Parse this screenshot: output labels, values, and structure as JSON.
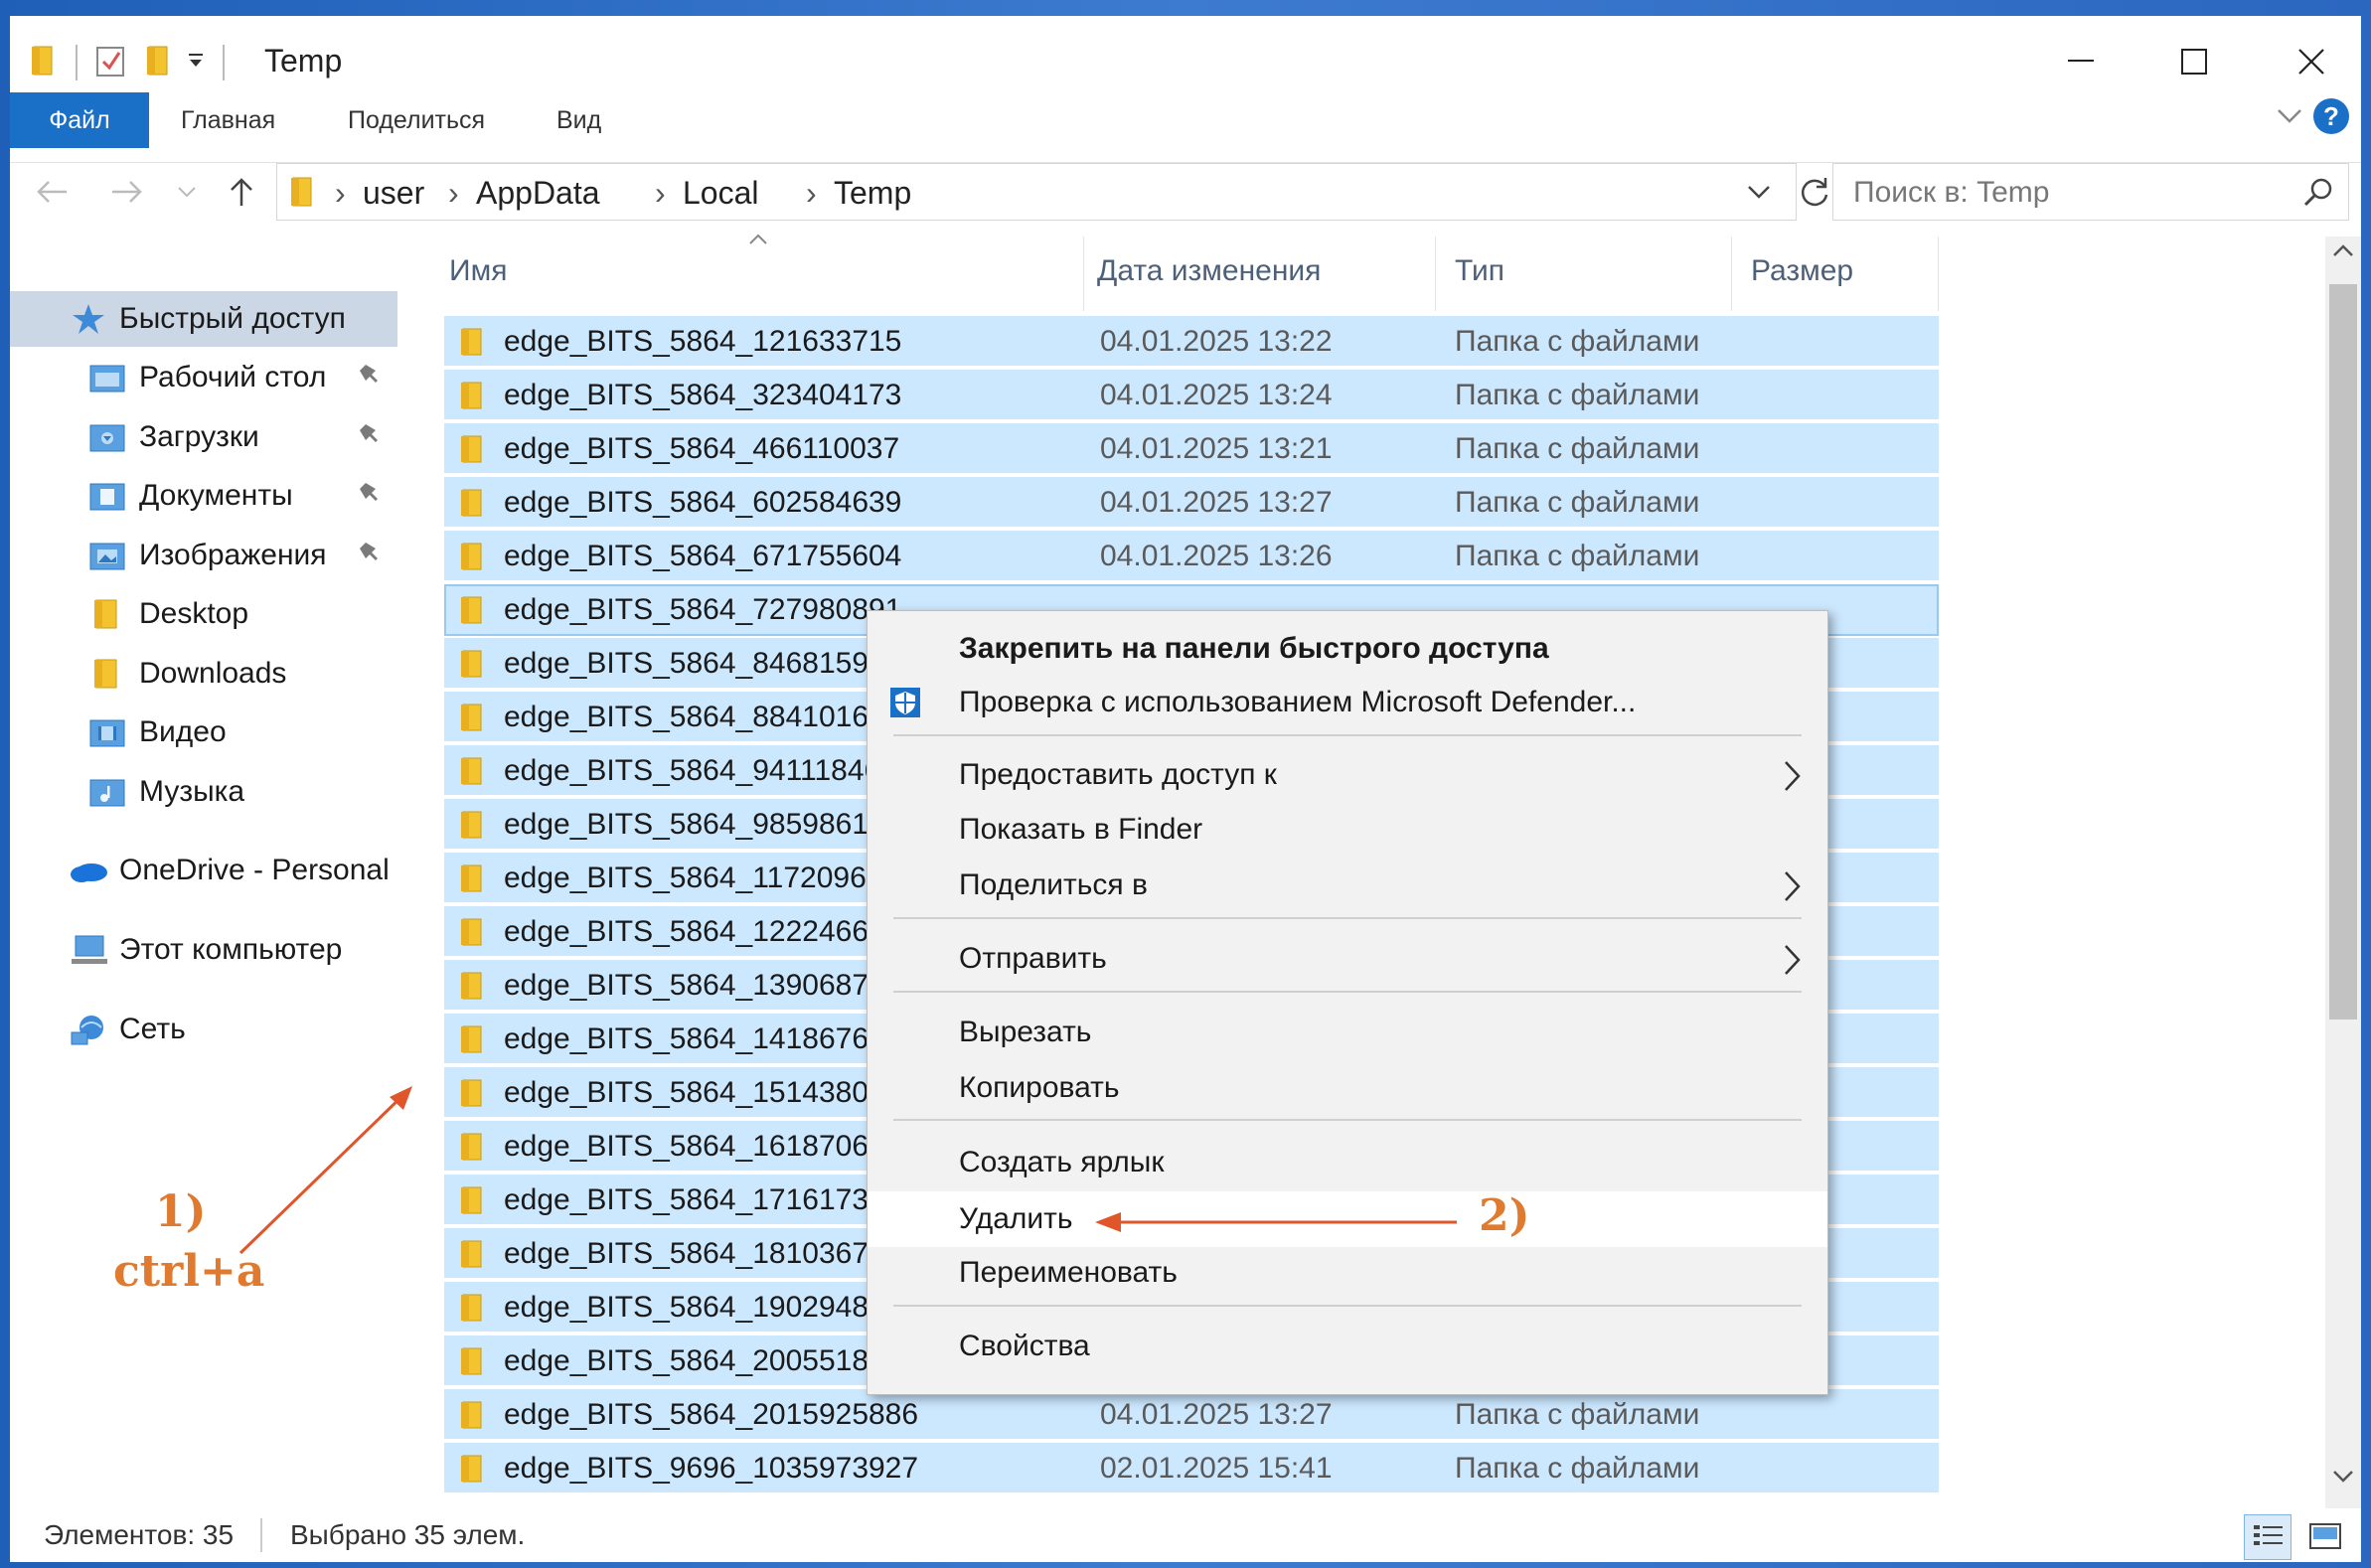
{
  "window": {
    "title": "Temp"
  },
  "ribbon": {
    "tabs": [
      "Файл",
      "Главная",
      "Поделиться",
      "Вид"
    ]
  },
  "address": {
    "crumbs": [
      "user",
      "AppData",
      "Local",
      "Temp"
    ]
  },
  "search": {
    "placeholder": "Поиск в: Temp"
  },
  "columns": {
    "name": "Имя",
    "date": "Дата изменения",
    "type": "Тип",
    "size": "Размер"
  },
  "nav": {
    "quick_access": "Быстрый доступ",
    "items": [
      {
        "label": "Рабочий стол",
        "icon": "desktop-folder-icon",
        "pinned": true
      },
      {
        "label": "Загрузки",
        "icon": "downloads-folder-icon",
        "pinned": true
      },
      {
        "label": "Документы",
        "icon": "documents-folder-icon",
        "pinned": true
      },
      {
        "label": "Изображения",
        "icon": "pictures-folder-icon",
        "pinned": true
      },
      {
        "label": "Desktop",
        "icon": "folder-icon",
        "pinned": false
      },
      {
        "label": "Downloads",
        "icon": "folder-icon",
        "pinned": false
      },
      {
        "label": "Видео",
        "icon": "videos-folder-icon",
        "pinned": false
      },
      {
        "label": "Музыка",
        "icon": "music-folder-icon",
        "pinned": false
      }
    ],
    "onedrive": "OneDrive - Personal",
    "this_pc": "Этот компьютер",
    "network": "Сеть"
  },
  "files": [
    {
      "name": "edge_BITS_5864_121633715",
      "date": "04.01.2025 13:22",
      "type": "Папка с файлами"
    },
    {
      "name": "edge_BITS_5864_323404173",
      "date": "04.01.2025 13:24",
      "type": "Папка с файлами"
    },
    {
      "name": "edge_BITS_5864_466110037",
      "date": "04.01.2025 13:21",
      "type": "Папка с файлами"
    },
    {
      "name": "edge_BITS_5864_602584639",
      "date": "04.01.2025 13:27",
      "type": "Папка с файлами"
    },
    {
      "name": "edge_BITS_5864_671755604",
      "date": "04.01.2025 13:26",
      "type": "Папка с файлами"
    },
    {
      "name": "edge_BITS_5864_727980891",
      "date": "",
      "type": ""
    },
    {
      "name": "edge_BITS_5864_846815911",
      "date": "",
      "type": ""
    },
    {
      "name": "edge_BITS_5864_884101607",
      "date": "",
      "type": ""
    },
    {
      "name": "edge_BITS_5864_941118469",
      "date": "",
      "type": ""
    },
    {
      "name": "edge_BITS_5864_985986181",
      "date": "",
      "type": ""
    },
    {
      "name": "edge_BITS_5864_117209649",
      "date": "",
      "type": ""
    },
    {
      "name": "edge_BITS_5864_122246613",
      "date": "",
      "type": ""
    },
    {
      "name": "edge_BITS_5864_139068765",
      "date": "",
      "type": ""
    },
    {
      "name": "edge_BITS_5864_141867614",
      "date": "",
      "type": ""
    },
    {
      "name": "edge_BITS_5864_151438019",
      "date": "",
      "type": ""
    },
    {
      "name": "edge_BITS_5864_161870672",
      "date": "",
      "type": ""
    },
    {
      "name": "edge_BITS_5864_171617388",
      "date": "",
      "type": ""
    },
    {
      "name": "edge_BITS_5864_181036728",
      "date": "",
      "type": ""
    },
    {
      "name": "edge_BITS_5864_190294856",
      "date": "",
      "type": ""
    },
    {
      "name": "edge_BITS_5864_200551850",
      "date": "",
      "type": ""
    },
    {
      "name": "edge_BITS_5864_2015925886",
      "date": "04.01.2025 13:27",
      "type": "Папка с файлами"
    },
    {
      "name": "edge_BITS_9696_1035973927",
      "date": "02.01.2025 15:41",
      "type": "Папка с файлами"
    }
  ],
  "context_menu": {
    "items": [
      {
        "label": "Закрепить на панели быстрого доступа",
        "bold": true
      },
      {
        "label": "Проверка с использованием Microsoft Defender...",
        "icon": "defender-shield-icon"
      },
      {
        "label": "Предоставить доступ к",
        "submenu": true
      },
      {
        "label": "Показать в Finder"
      },
      {
        "label": "Поделиться в",
        "submenu": true
      },
      {
        "label": "Отправить",
        "submenu": true
      },
      {
        "label": "Вырезать"
      },
      {
        "label": "Копировать"
      },
      {
        "label": "Создать ярлык"
      },
      {
        "label": "Удалить",
        "highlighted": true
      },
      {
        "label": "Переименовать"
      },
      {
        "label": "Свойства"
      }
    ]
  },
  "status": {
    "count": "Элементов: 35",
    "selected": "Выбрано 35 элем."
  },
  "annotations": {
    "step1_num": "1)",
    "step1_text": "ctrl+a",
    "step2": "2)"
  },
  "colors": {
    "accent": "#1a6fc7",
    "selection": "#cce8ff",
    "annotation": "#e07a2e",
    "folder": "#f4c430"
  }
}
